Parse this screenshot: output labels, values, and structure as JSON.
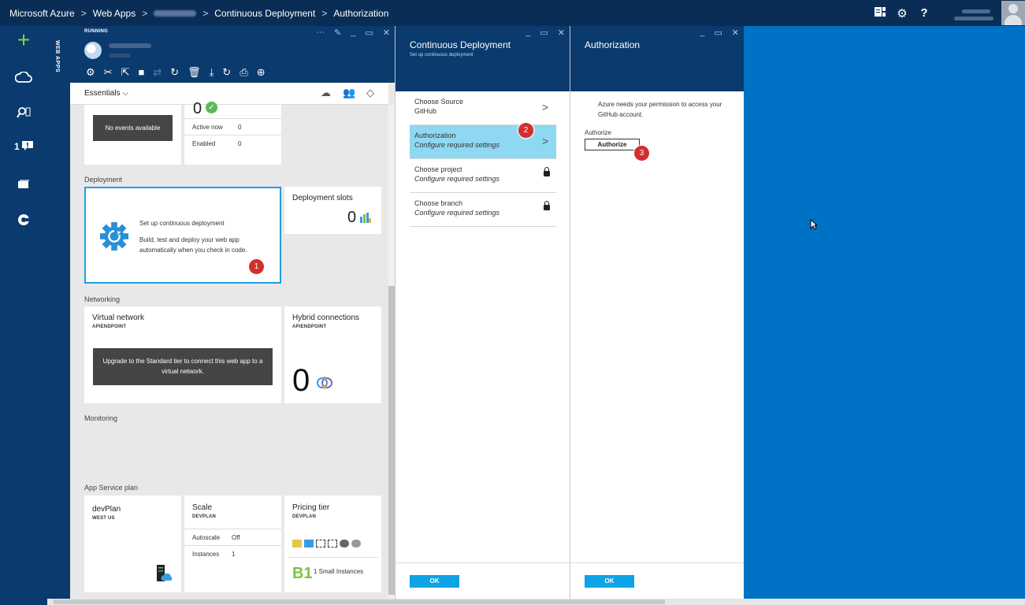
{
  "topbar": {
    "crumbs": [
      "Microsoft Azure",
      "Web Apps",
      "Continuous Deployment",
      "Authorization"
    ],
    "separator": ">"
  },
  "leftnav": {
    "notification_count": "1"
  },
  "side_strip": {
    "label": "WEB APPS"
  },
  "webapp_blade": {
    "status": "RUNNING",
    "essentials_label": "Essentials",
    "events_tile": {
      "big_number": "0",
      "no_events": "No events available",
      "rows": [
        {
          "key": "Active now",
          "value": "0"
        },
        {
          "key": "Enabled",
          "value": "0"
        }
      ]
    },
    "deployment": {
      "section": "Deployment",
      "cd_title": "Set up continuous deployment",
      "cd_desc": "Build, test and deploy your web app automatically when you check in code.",
      "slots_title": "Deployment slots",
      "slots_count": "0"
    },
    "networking": {
      "section": "Networking",
      "vnet_title": "Virtual network",
      "vnet_sub": "APIENDPOINT",
      "vnet_msg": "Upgrade to the Standard tier to connect this web app to a virtual network.",
      "hybrid_title": "Hybrid connections",
      "hybrid_sub": "APIENDPOINT",
      "hybrid_count": "0"
    },
    "monitoring": {
      "section": "Monitoring"
    },
    "plan": {
      "section": "App Service plan",
      "name": "devPlan",
      "region": "WEST US",
      "scale_title": "Scale",
      "scale_sub": "DEVPLAN",
      "rows": [
        {
          "key": "Autoscale",
          "value": "Off"
        },
        {
          "key": "Instances",
          "value": "1"
        }
      ],
      "tier_title": "Pricing tier",
      "tier_sub": "DEVPLAN",
      "tier_code": "B1",
      "tier_desc": "1 Small Instances"
    }
  },
  "cd_blade": {
    "title": "Continuous Deployment",
    "subtitle": "Set up continuous deployment",
    "steps": [
      {
        "title": "Choose Source",
        "value": "GitHub"
      },
      {
        "title": "Authorization",
        "value": "Configure required settings"
      },
      {
        "title": "Choose project",
        "value": "Configure required settings"
      },
      {
        "title": "Choose branch",
        "value": "Configure required settings"
      }
    ],
    "ok": "OK"
  },
  "auth_blade": {
    "title": "Authorization",
    "message": "Azure needs your permission to access your GitHub account.",
    "field_label": "Authorize",
    "button": "Authorize",
    "ok": "OK"
  },
  "callouts": [
    "1",
    "2",
    "3"
  ],
  "colors": {
    "portal_blue": "#0072c6",
    "nav_dark": "#0a3a6e",
    "selected_row": "#8fd8f2",
    "ok_button": "#0ea3e6",
    "callout_red": "#d32f2f"
  }
}
